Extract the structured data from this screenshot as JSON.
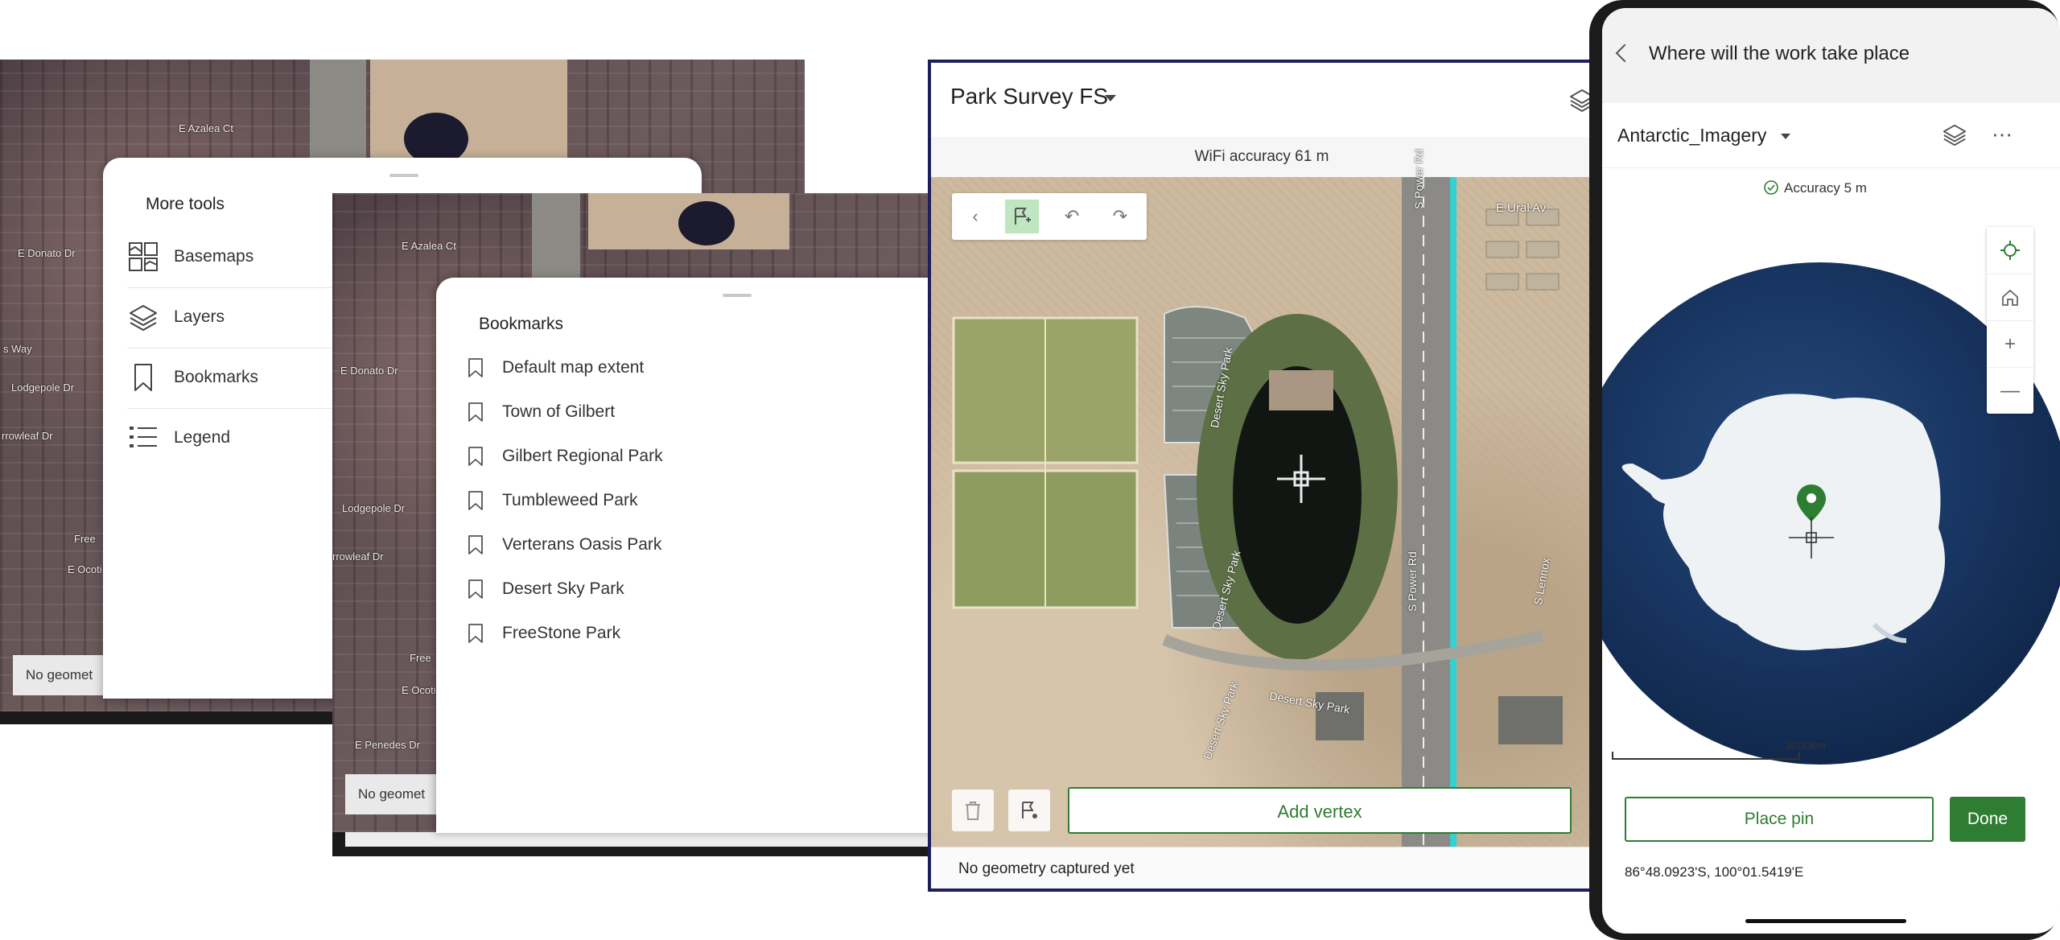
{
  "screen1": {
    "map_labels": [
      "E Azalea Ct",
      "E Donato Dr",
      "Lodgepole Dr",
      "rrowleaf Dr",
      "Free",
      "E Ocoti",
      "E Penedes Dr",
      "s Way"
    ],
    "sheet_title": "More tools",
    "tools": [
      {
        "label": "Basemaps",
        "icon": "basemap-gallery-icon"
      },
      {
        "label": "Layers",
        "icon": "layers-icon"
      },
      {
        "label": "Bookmarks",
        "icon": "bookmark-icon"
      },
      {
        "label": "Legend",
        "icon": "legend-icon"
      }
    ],
    "status_chip": "No geomet"
  },
  "screen2": {
    "map_labels": [
      "E Azalea Ct",
      "E Donato Dr",
      "Lodgepole Dr",
      "rrowleaf Dr",
      "Free",
      "E Ocotil",
      "E Penedes Dr"
    ],
    "sheet_title": "Bookmarks",
    "bookmarks": [
      "Default map extent",
      "Town of Gilbert",
      "Gilbert Regional Park",
      "Tumbleweed Park",
      "Verterans Oasis Park",
      "Desert Sky Park",
      "FreeStone Park"
    ],
    "status_chip": "No geomet"
  },
  "screen3": {
    "title": "Park Survey FS",
    "accuracy": "WiFi accuracy 61 m",
    "map_labels": [
      "S Power Rd",
      "E Ural Av",
      "Desert Sky Park",
      "Desert Sky Park",
      "S Power Rd",
      "S Lennox",
      "Desert Sky Park",
      "Desert Sky Park"
    ],
    "add_vertex": "Add vertex",
    "status": "No geometry captured yet"
  },
  "screen4": {
    "title": "Where will the work take place",
    "map_name": "Antarctic_Imagery",
    "accuracy": "Accuracy 5 m",
    "scale_label": "3000km",
    "place_pin": "Place pin",
    "done": "Done",
    "coordinates": "86°48.0923'S, 100°01.5419'E"
  },
  "colors": {
    "accent_green": "#2e7d32",
    "frame_navy": "#1d1f5c",
    "ocean": "#183561"
  }
}
